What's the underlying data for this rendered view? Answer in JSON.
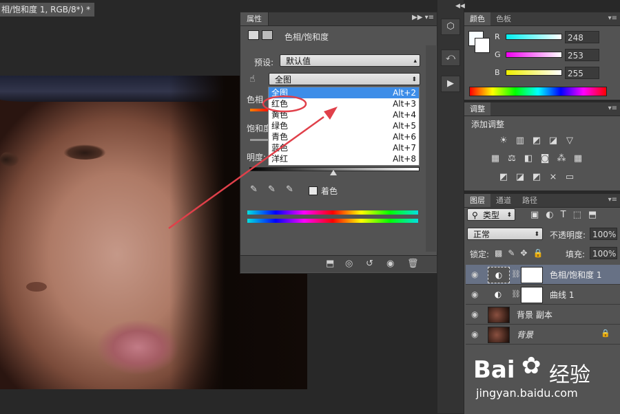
{
  "document": {
    "tab_title": "相/饱和度 1, RGB/8*) *",
    "close": "×"
  },
  "properties_panel": {
    "tab": "属性",
    "heading": "色相/饱和度",
    "preset_label": "预设:",
    "preset_value": "默认值",
    "channel_value": "全图",
    "hue_label": "色相",
    "saturation_label": "饱和度",
    "lightness_label": "明度:",
    "colorize_label": "着色",
    "dropdown_items": [
      {
        "label": "全图",
        "shortcut": "Alt+2",
        "selected": true
      },
      {
        "label": "红色",
        "shortcut": "Alt+3",
        "selected": false
      },
      {
        "label": "黄色",
        "shortcut": "Alt+4",
        "selected": false
      },
      {
        "label": "绿色",
        "shortcut": "Alt+5",
        "selected": false
      },
      {
        "label": "青色",
        "shortcut": "Alt+6",
        "selected": false
      },
      {
        "label": "蓝色",
        "shortcut": "Alt+7",
        "selected": false
      },
      {
        "label": "洋红",
        "shortcut": "Alt+8",
        "selected": false
      }
    ],
    "selection_color": "#3d8de8",
    "annotation_color": "#e0404a"
  },
  "color_panel": {
    "tabs": [
      "颜色",
      "色板"
    ],
    "channels": [
      {
        "label": "R",
        "value": "248",
        "color": "#19e0e6"
      },
      {
        "label": "G",
        "value": "253",
        "color": "#e040e0"
      },
      {
        "label": "B",
        "value": "255",
        "color": "#f0e040"
      }
    ]
  },
  "adjustments_panel": {
    "tab": "调整",
    "title": "添加调整"
  },
  "layers_panel": {
    "tabs": [
      "图层",
      "通道",
      "路径"
    ],
    "filter": "类型",
    "blend_mode": "正常",
    "opacity_label": "不透明度:",
    "opacity_value": "100%",
    "lock_label": "锁定:",
    "fill_label": "填充:",
    "fill_value": "100%",
    "layers": [
      {
        "name": "色相/饱和度 1",
        "active": true
      },
      {
        "name": "曲线 1",
        "active": false
      },
      {
        "name": "背景 副本",
        "active": false
      },
      {
        "name": "背景",
        "active": false
      }
    ]
  },
  "watermark": {
    "brand": "Bai",
    "brand2": "经验",
    "url": "jingyan.baidu.com"
  }
}
